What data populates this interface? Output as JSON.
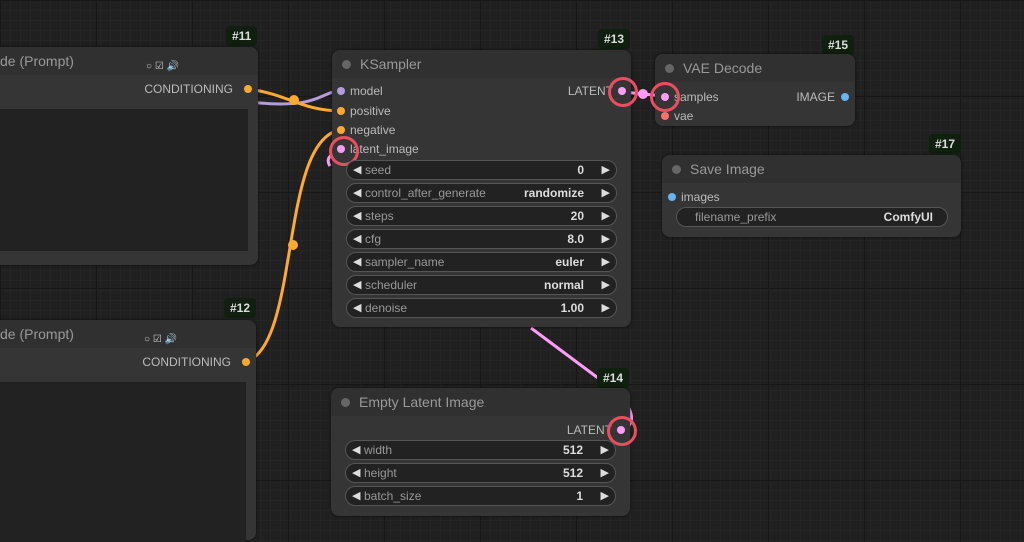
{
  "nodes": {
    "n11": {
      "id": "#11",
      "title": "de (Prompt)",
      "output": "CONDITIONING"
    },
    "n12": {
      "id": "#12",
      "title": "de (Prompt)",
      "output": "CONDITIONING"
    },
    "n13": {
      "id": "#13",
      "title": "KSampler",
      "output": "LATENT",
      "inputs": [
        "model",
        "positive",
        "negative",
        "latent_image"
      ],
      "widgets": [
        {
          "label": "seed",
          "value": "0"
        },
        {
          "label": "control_after_generate",
          "value": "randomize"
        },
        {
          "label": "steps",
          "value": "20"
        },
        {
          "label": "cfg",
          "value": "8.0"
        },
        {
          "label": "sampler_name",
          "value": "euler"
        },
        {
          "label": "scheduler",
          "value": "normal"
        },
        {
          "label": "denoise",
          "value": "1.00"
        }
      ]
    },
    "n14": {
      "id": "#14",
      "title": "Empty Latent Image",
      "output": "LATENT",
      "widgets": [
        {
          "label": "width",
          "value": "512"
        },
        {
          "label": "height",
          "value": "512"
        },
        {
          "label": "batch_size",
          "value": "1"
        }
      ]
    },
    "n15": {
      "id": "#15",
      "title": "VAE Decode",
      "inputs": [
        "samples",
        "vae"
      ],
      "output": "IMAGE"
    },
    "n17": {
      "id": "#17",
      "title": "Save Image",
      "inputs": [
        "images"
      ],
      "widgets": [
        {
          "label": "filename_prefix",
          "value": "ComfyUI"
        }
      ]
    }
  },
  "arrows": {
    "left": "◀",
    "right": "▶"
  },
  "colors": {
    "conditioning": "#ffa931",
    "model": "#b39ddb",
    "latent": "#ff9cf9",
    "image": "#64b5f6",
    "vae": "#ff6e6e",
    "highlight": "#ee4d5f"
  }
}
